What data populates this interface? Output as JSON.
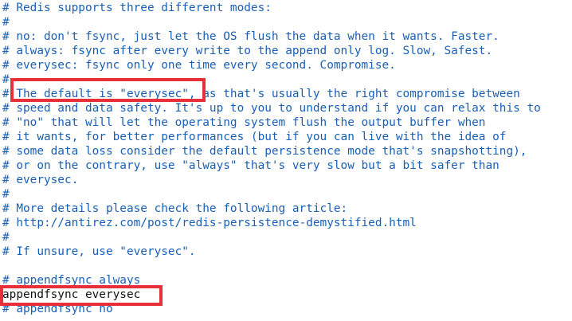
{
  "editor": {
    "lines": [
      "# Redis supports three different modes:",
      "#",
      "# no: don't fsync, just let the OS flush the data when it wants. Faster.",
      "# always: fsync after every write to the append only log. Slow, Safest.",
      "# everysec: fsync only one time every second. Compromise.",
      "#",
      "# The default is \"everysec\", as that's usually the right compromise between",
      "# speed and data safety. It's up to you to understand if you can relax this to",
      "# \"no\" that will let the operating system flush the output buffer when",
      "# it wants, for better performances (but if you can live with the idea of",
      "# some data loss consider the default persistence mode that's snapshotting),",
      "# or on the contrary, use \"always\" that's very slow but a bit safer than",
      "# everysec.",
      "#",
      "# More details please check the following article:",
      "# http://antirez.com/post/redis-persistence-demystified.html",
      "#",
      "# If unsure, use \"everysec\".",
      "",
      "# appendfsync always",
      "appendfsync everysec",
      "# appendfsync no"
    ]
  },
  "colors": {
    "comment": "#1a5fb4",
    "code": "#111111",
    "highlight": "#e8303a",
    "background": "#ffffff"
  }
}
